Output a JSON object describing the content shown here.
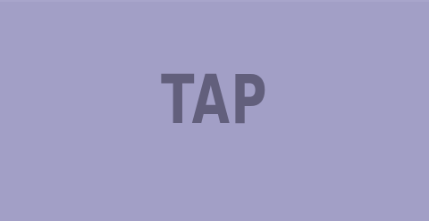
{
  "screen": {
    "background_color": "#a29fc6",
    "prompt_text": "TAP",
    "prompt_color": "#625f7c"
  }
}
